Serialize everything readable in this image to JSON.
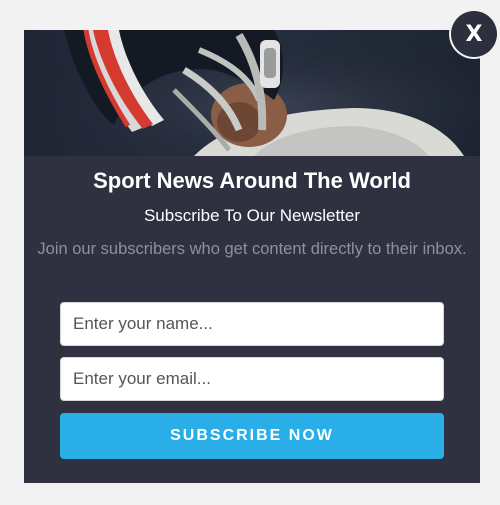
{
  "popup": {
    "close_label": "X",
    "title": "Sport News Around The World",
    "subtitle": "Subscribe To Our Newsletter",
    "description": "Join our subscribers who get content directly to their inbox.",
    "name_field": {
      "placeholder": "Enter your name...",
      "value": ""
    },
    "email_field": {
      "placeholder": "Enter your email...",
      "value": ""
    },
    "submit_label": "SUBSCRIBE NOW"
  },
  "colors": {
    "page_background": "#f2f2f2",
    "popup_background": "#2f3141",
    "button_accent": "#29aee8",
    "description_text": "#8e909b"
  },
  "icons": {
    "close": "close-icon",
    "hero": "football-player-image"
  }
}
